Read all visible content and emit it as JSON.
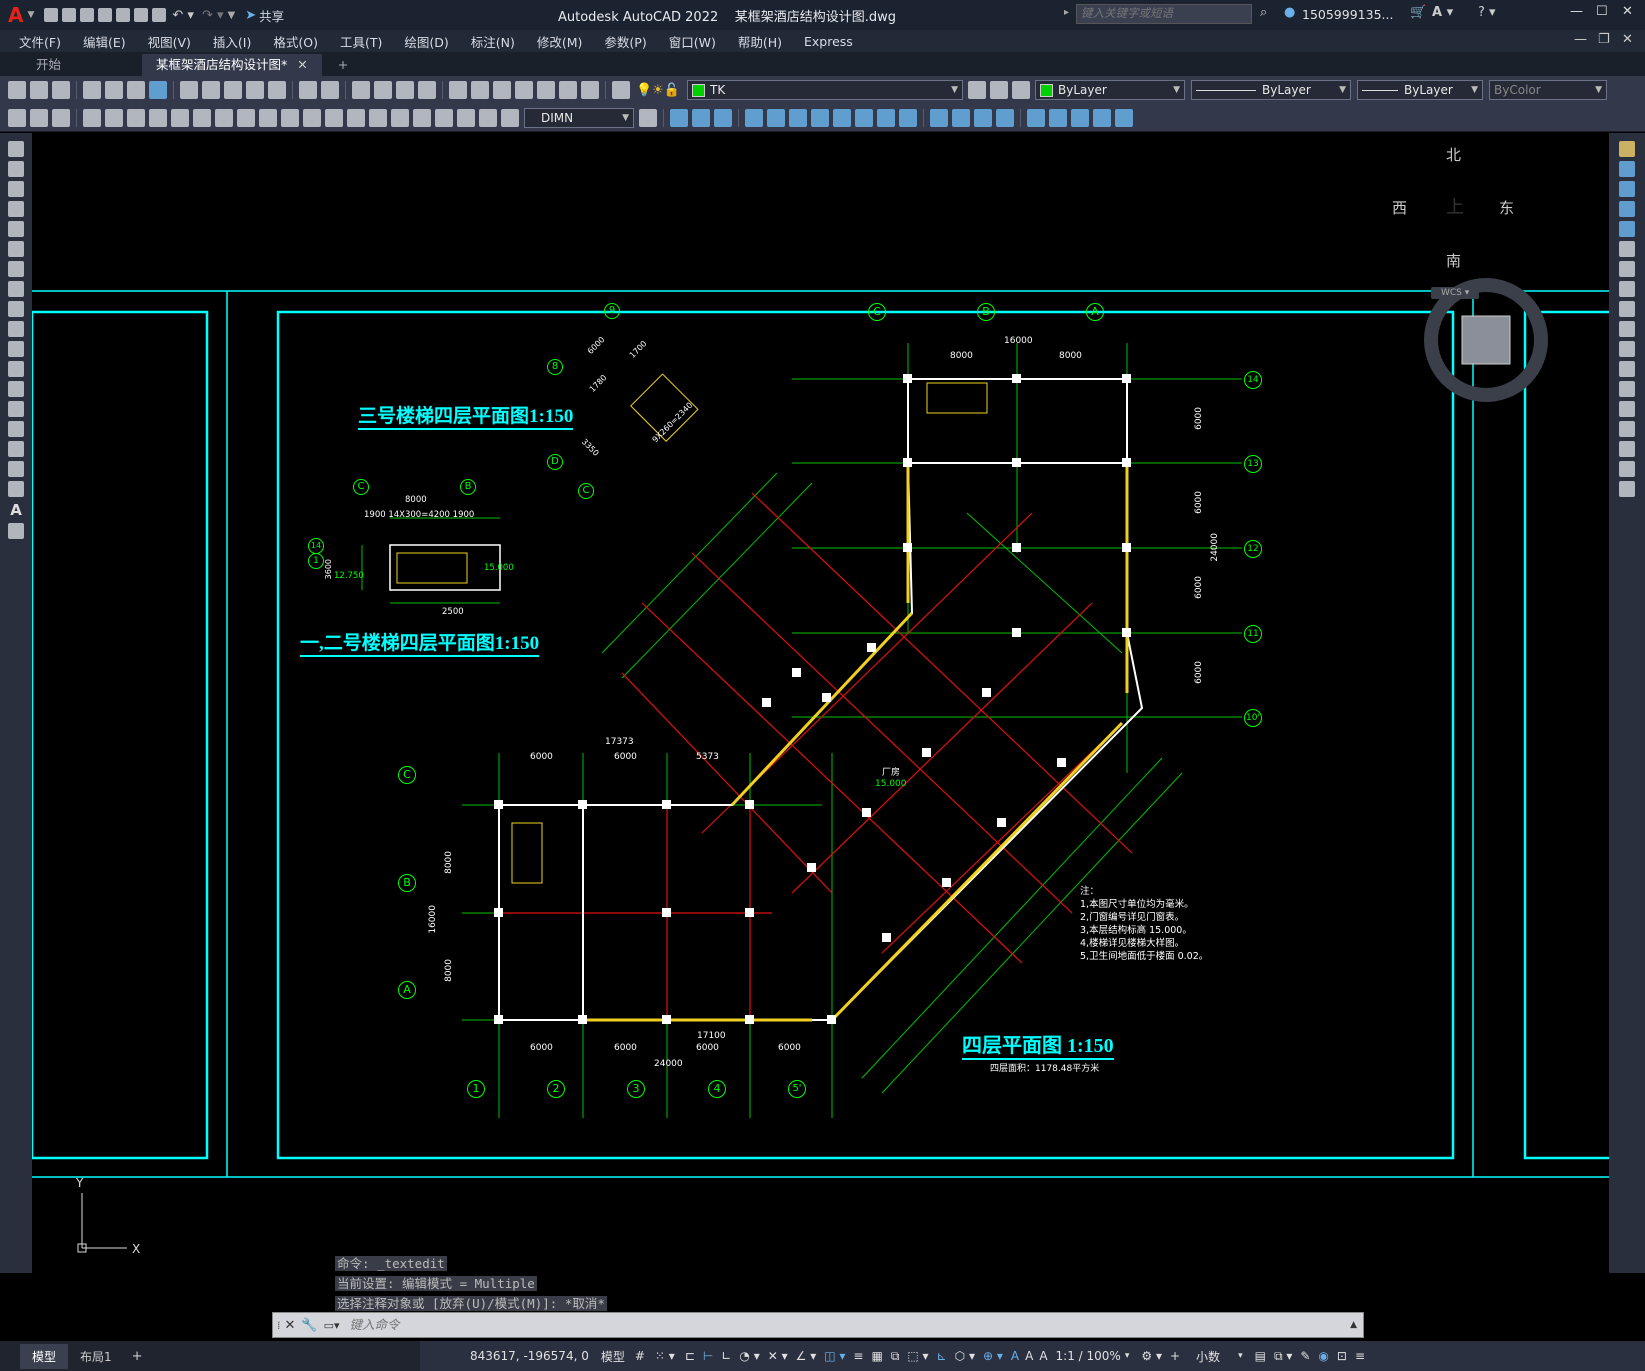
{
  "app": {
    "logo": "A",
    "title": "Autodesk AutoCAD 2022",
    "file": "某框架酒店结构设计图.dwg",
    "share": "共享",
    "search_placeholder": "键入关键字或短语",
    "user": "1505999135...",
    "window_controls": [
      "minimize",
      "maximize",
      "close"
    ]
  },
  "menu": [
    "文件(F)",
    "编辑(E)",
    "视图(V)",
    "插入(I)",
    "格式(O)",
    "工具(T)",
    "绘图(D)",
    "标注(N)",
    "修改(M)",
    "参数(P)",
    "窗口(W)",
    "帮助(H)",
    "Express"
  ],
  "tabs": [
    "开始",
    "某框架酒店结构设计图*"
  ],
  "layer": {
    "name": "TK",
    "color": "#00d000"
  },
  "props": {
    "color": "ByLayer",
    "linetype": "ByLayer",
    "lineweight": "ByLayer",
    "plotstyle": "ByColor"
  },
  "dimstyle": "DIMN",
  "viewcube": {
    "north": "北",
    "south": "南",
    "west": "西",
    "east": "东",
    "top": "上",
    "wcs": "WCS"
  },
  "drawing": {
    "title_main": "四层平面图 1:150",
    "area_note": "四层面积：1178.48平方米",
    "title_stair3": "三号楼梯四层平面图1:150",
    "title_stair12": "一,二号楼梯四层平面图1:150",
    "notes_head": "注：",
    "notes": [
      "1,本图尺寸单位均为毫米。",
      "2,门窗编号详见门窗表。",
      "3,本层结构标高 15.000。",
      "4,楼梯详见楼梯大样图。",
      "5,卫生间地面低于楼面 0.02。"
    ],
    "hall": "厂房",
    "level": "15.000",
    "axes_bottom": [
      "1",
      "2",
      "3",
      "4",
      "5'"
    ],
    "axes_left": [
      "C",
      "B",
      "A"
    ],
    "axes_top": [
      "C",
      "B",
      "A"
    ],
    "axes_right": [
      "14",
      "13",
      "12",
      "11",
      "10'"
    ],
    "dims_bottom_total": "24000",
    "dims_bottom": [
      "6000",
      "6000",
      "6000",
      "6000"
    ],
    "dims_top_total": "17373",
    "dims_top": [
      "6000",
      "6000",
      "5373"
    ],
    "dims_top_upper": "16000",
    "dims_top_upper_parts": [
      "8000",
      "8000"
    ],
    "dims_left": [
      "8000",
      "8000"
    ],
    "dims_left_total": "16000",
    "dims_right": [
      "6000",
      "6000",
      "6000",
      "6000"
    ],
    "dims_right_total": "24000",
    "dims_mid": "17100",
    "stair12_axes": [
      "C",
      "B",
      "14",
      "1"
    ],
    "stair12_dims": [
      "8000",
      "1900",
      "14X300=4200",
      "1900",
      "2500",
      "3600"
    ],
    "stair12_levels": [
      "12.750",
      "15.000"
    ],
    "stair3_axes": [
      "9",
      "8",
      "D",
      "C"
    ],
    "stair3_dims": [
      "6000",
      "1700",
      "1780",
      "3350",
      "9X260=2340"
    ]
  },
  "command": {
    "history": [
      "命令: _textedit",
      "当前设置: 编辑模式 = Multiple",
      "选择注释对象或 [放弃(U)/模式(M)]: *取消*"
    ],
    "placeholder": "键入命令"
  },
  "layout_tabs": [
    "模型",
    "布局1"
  ],
  "status": {
    "coords": "843617, -196574, 0",
    "mode": "模型",
    "scale": "1:1 / 100%",
    "units": "小数"
  }
}
